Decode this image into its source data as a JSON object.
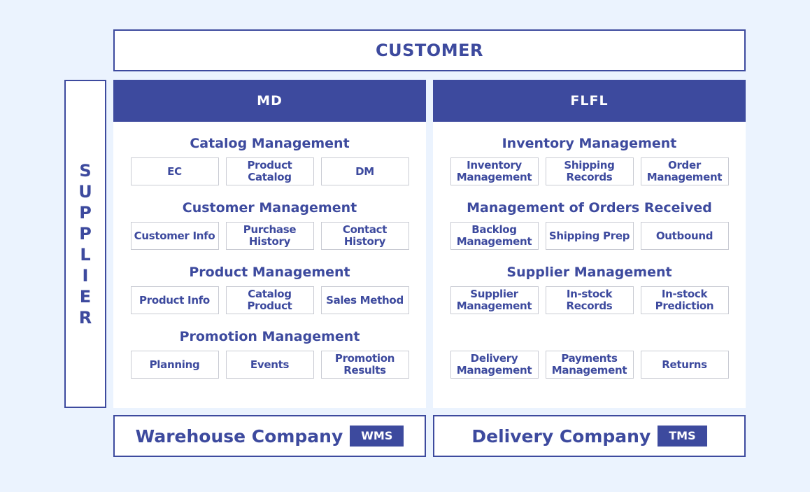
{
  "customer": {
    "label": "CUSTOMER"
  },
  "supplier": {
    "letters": [
      "S",
      "U",
      "P",
      "P",
      "L",
      "I",
      "E",
      "R"
    ]
  },
  "colors": {
    "primary": "#3d4a9e",
    "background": "#ebf3fe",
    "box_border": "#c9cbd3"
  },
  "md": {
    "title": "MD",
    "sections": [
      {
        "title": "Catalog Management",
        "items": [
          "EC",
          "Product\nCatalog",
          "DM"
        ]
      },
      {
        "title": "Customer Management",
        "items": [
          "Customer Info",
          "Purchase\nHistory",
          "Contact History"
        ]
      },
      {
        "title": "Product Management",
        "items": [
          "Product Info",
          "Catalog\nProduct",
          "Sales Method"
        ]
      },
      {
        "title": "Promotion Management",
        "items": [
          "Planning",
          "Events",
          "Promotion\nResults"
        ]
      }
    ]
  },
  "flfl": {
    "title": "FLFL",
    "sections": [
      {
        "title": "Inventory Management",
        "items": [
          "Inventory\nManagement",
          "Shipping\nRecords",
          "Order\nManagement"
        ]
      },
      {
        "title": "Management of Orders Received",
        "items": [
          "Backlog\nManagement",
          "Shipping Prep",
          "Outbound"
        ]
      },
      {
        "title": "Supplier Management",
        "items": [
          "Supplier\nManagement",
          "In-stock\nRecords",
          "In-stock\nPrediction"
        ]
      },
      {
        "title": "",
        "items": [
          "Delivery\nManagement",
          "Payments\nManagement",
          "Returns"
        ]
      }
    ]
  },
  "warehouse": {
    "name": "Warehouse Company",
    "tag": "WMS"
  },
  "delivery": {
    "name": "Delivery Company",
    "tag": "TMS"
  }
}
